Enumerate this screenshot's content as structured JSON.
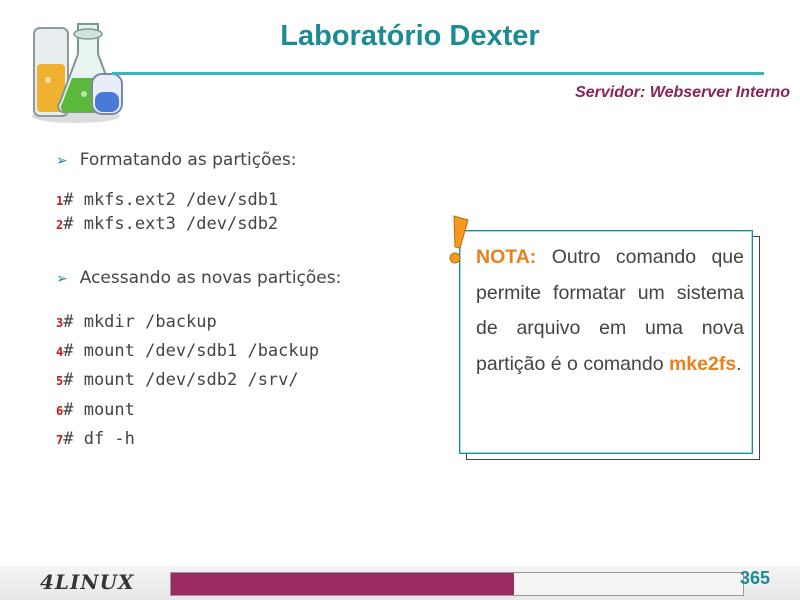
{
  "header": {
    "title": "Laboratório Dexter",
    "subtitle": "Servidor: Webserver Interno"
  },
  "sections": [
    {
      "heading": "Formatando as partições:",
      "commands": [
        {
          "num": "1",
          "text": "# mkfs.ext2 /dev/sdb1"
        },
        {
          "num": "2",
          "text": "# mkfs.ext3 /dev/sdb2"
        }
      ]
    },
    {
      "heading": "Acessando as novas partições:",
      "commands": [
        {
          "num": "3",
          "text": "# mkdir /backup"
        },
        {
          "num": "4",
          "text": "# mount /dev/sdb1 /backup"
        },
        {
          "num": "5",
          "text": "# mount /dev/sdb2 /srv/"
        },
        {
          "num": "6",
          "text": "# mount"
        },
        {
          "num": "7",
          "text": "# df -h"
        }
      ]
    }
  ],
  "note": {
    "label": "NOTA:",
    "text": " Outro comando que permite formatar um sistema de arquivo em uma nova partição é o comando ",
    "command": "mke2fs",
    "end": "."
  },
  "footer": {
    "brand": "4LINUX",
    "page_number": "365",
    "progress_fraction": 0.6
  },
  "colors": {
    "title": "#1c8b93",
    "subtitle": "#8a2358",
    "line_number": "#c51a1a",
    "note_highlight": "#e8801b",
    "progress": "#9a2c62"
  }
}
